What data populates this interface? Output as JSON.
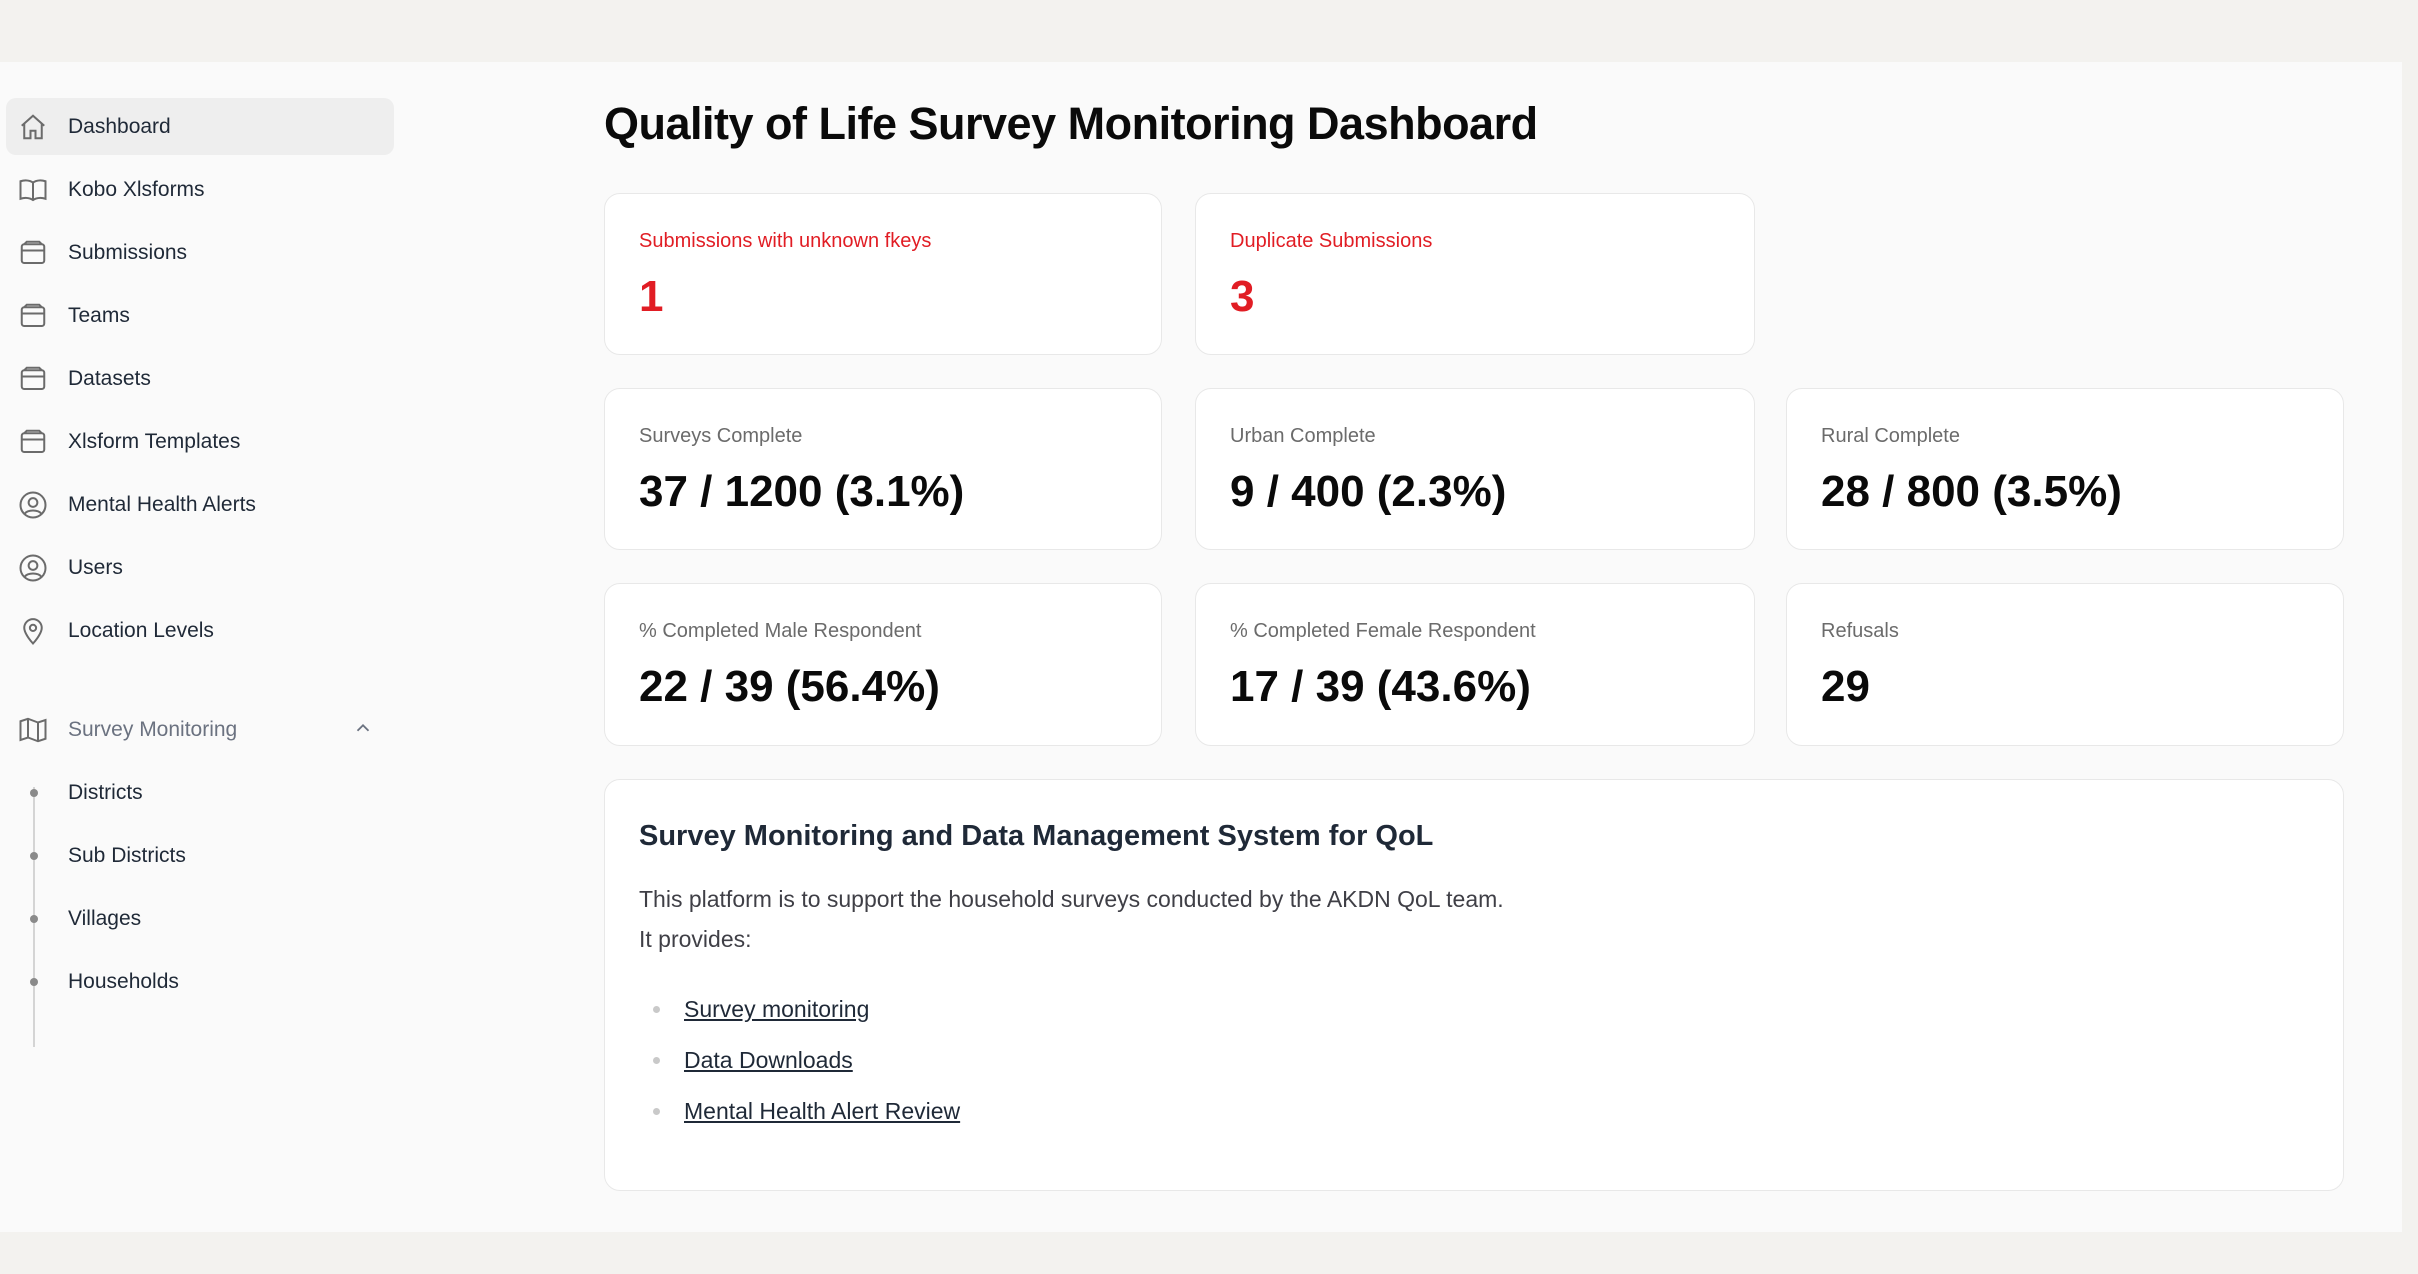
{
  "sidebar": {
    "items": [
      {
        "label": "Dashboard",
        "icon": "home-icon",
        "active": true
      },
      {
        "label": "Kobo Xlsforms",
        "icon": "book-icon"
      },
      {
        "label": "Submissions",
        "icon": "tray-icon"
      },
      {
        "label": "Teams",
        "icon": "tray-icon"
      },
      {
        "label": "Datasets",
        "icon": "tray-icon"
      },
      {
        "label": "Xlsform Templates",
        "icon": "tray-icon"
      },
      {
        "label": "Mental Health Alerts",
        "icon": "user-circle-icon"
      },
      {
        "label": "Users",
        "icon": "user-circle-icon"
      },
      {
        "label": "Location Levels",
        "icon": "map-pin-icon"
      }
    ],
    "group": {
      "label": "Survey Monitoring",
      "icon": "map-icon",
      "expanded": true,
      "children": [
        "Districts",
        "Sub Districts",
        "Villages",
        "Households"
      ]
    }
  },
  "main": {
    "title": "Quality of Life Survey Monitoring Dashboard",
    "alerts": [
      {
        "label": "Submissions with unknown fkeys",
        "value": "1"
      },
      {
        "label": "Duplicate Submissions",
        "value": "3"
      }
    ],
    "stats_row1": [
      {
        "label": "Surveys Complete",
        "value": "37 / 1200 (3.1%)"
      },
      {
        "label": "Urban Complete",
        "value": "9 / 400 (2.3%)"
      },
      {
        "label": "Rural Complete",
        "value": "28 / 800 (3.5%)"
      }
    ],
    "stats_row2": [
      {
        "label": "% Completed Male Respondent",
        "value": "22 / 39 (56.4%)"
      },
      {
        "label": "% Completed Female Respondent",
        "value": "17 / 39 (43.6%)"
      },
      {
        "label": "Refusals",
        "value": "29"
      }
    ],
    "info": {
      "title": "Survey Monitoring and Data Management System for QoL",
      "line1": "This platform is to support the household surveys conducted by the AKDN QoL team.",
      "line2": "It provides:",
      "links": [
        "Survey monitoring",
        "Data Downloads",
        "Mental Health Alert Review"
      ]
    }
  },
  "colors": {
    "alert": "#e11d24",
    "page_bg": "#f3f2ef",
    "app_bg": "#fafafa",
    "card_bg": "#ffffff"
  }
}
